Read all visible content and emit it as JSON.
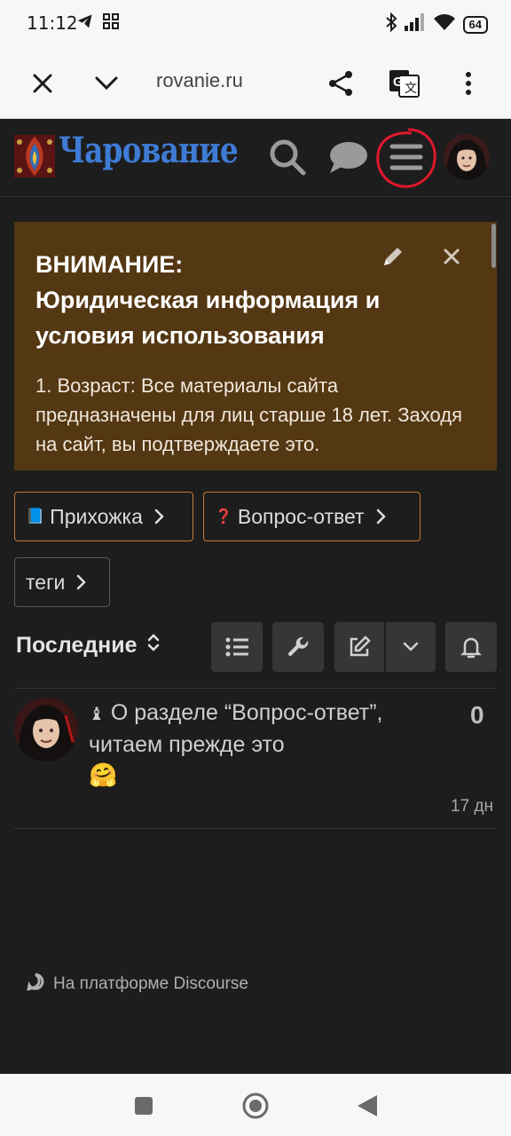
{
  "status_bar": {
    "time": "11:12",
    "battery": "64"
  },
  "browser": {
    "url": "rovanie.ru",
    "icons": [
      "close-icon",
      "chevron-down-icon",
      "share-icon",
      "translate-icon",
      "more-vert-icon"
    ]
  },
  "header": {
    "logo_text": "Чарование",
    "icons": [
      "search-icon",
      "chat-icon",
      "hamburger-menu-icon",
      "user-avatar"
    ],
    "accent_color": "#3e7bd5",
    "highlight_color": "#e0182b"
  },
  "banner": {
    "title": "ВНИМАНИЕ:\nЮридическая информация и условия использования",
    "text": "1. Возраст: Все материалы сайта предназначены для лиц старше 18 лет. Заходя на сайт, вы подтверждаете это.",
    "background": "#543713"
  },
  "nav_pills": {
    "categories": [
      {
        "icon": "📘",
        "label": "Прихожка"
      },
      {
        "icon": "❓",
        "label": "Вопрос-ответ"
      }
    ],
    "tags_label": "теги"
  },
  "list": {
    "sort_label": "Последние",
    "controls": [
      "list-icon",
      "wrench-icon",
      "new-topic-icon",
      "chevron-down-icon",
      "bell-icon"
    ]
  },
  "topic": {
    "pin_icon": "♝",
    "title": "О разделе “Вопрос-ответ”, читаем прежде это",
    "emoji": "🤗",
    "replies": "0",
    "age": "17 дн"
  },
  "footer": {
    "powered_by": "На платформе Discourse"
  }
}
